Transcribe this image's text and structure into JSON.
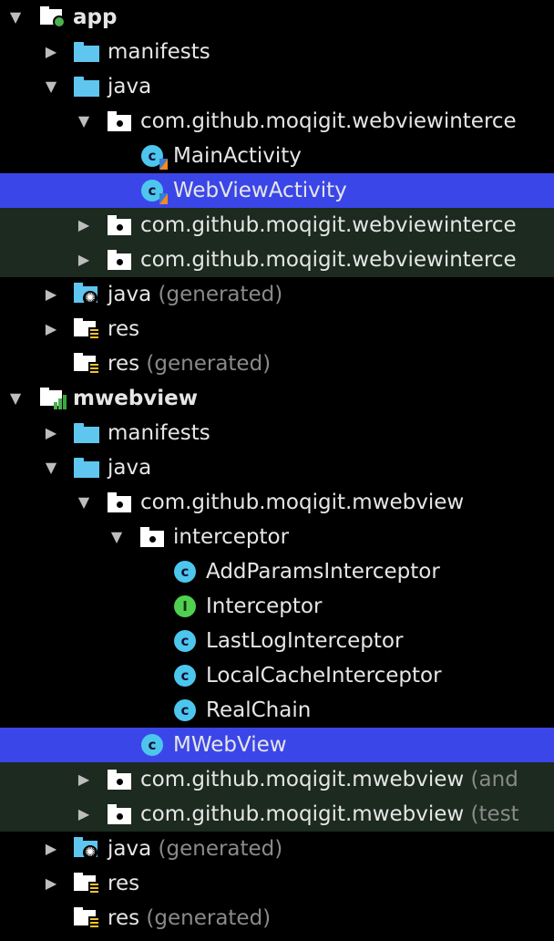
{
  "tree": {
    "rows": [
      {
        "label": "app",
        "suffix": "",
        "level": 0,
        "arrow": "expanded",
        "icon": "module-app-icon",
        "state": "",
        "bold": true
      },
      {
        "label": "manifests",
        "suffix": "",
        "level": 1,
        "arrow": "collapsed",
        "icon": "folder-icon",
        "state": ""
      },
      {
        "label": "java",
        "suffix": "",
        "level": 1,
        "arrow": "expanded",
        "icon": "folder-icon",
        "state": ""
      },
      {
        "label": "com.github.moqigit.webviewinterce",
        "suffix": "",
        "level": 2,
        "arrow": "expanded",
        "icon": "package-icon",
        "state": ""
      },
      {
        "label": "MainActivity",
        "suffix": "",
        "level": 3,
        "arrow": "none",
        "icon": "kotlin-class-icon",
        "state": ""
      },
      {
        "label": "WebViewActivity",
        "suffix": "",
        "level": 3,
        "arrow": "none",
        "icon": "kotlin-class-icon",
        "state": "selected"
      },
      {
        "label": "com.github.moqigit.webviewinterce",
        "suffix": "",
        "level": 2,
        "arrow": "collapsed",
        "icon": "package-icon",
        "state": "test"
      },
      {
        "label": "com.github.moqigit.webviewinterce",
        "suffix": "",
        "level": 2,
        "arrow": "collapsed",
        "icon": "package-icon",
        "state": "test"
      },
      {
        "label": "java",
        "suffix": "(generated)",
        "level": 1,
        "arrow": "collapsed",
        "icon": "generated-java-folder-icon",
        "state": ""
      },
      {
        "label": "res",
        "suffix": "",
        "level": 1,
        "arrow": "collapsed",
        "icon": "resource-folder-icon",
        "state": ""
      },
      {
        "label": "res",
        "suffix": "(generated)",
        "level": 1,
        "arrow": "none",
        "icon": "resource-folder-icon",
        "state": ""
      },
      {
        "label": "mwebview",
        "suffix": "",
        "level": 0,
        "arrow": "expanded",
        "icon": "module-library-icon",
        "state": "",
        "bold": true
      },
      {
        "label": "manifests",
        "suffix": "",
        "level": 1,
        "arrow": "collapsed",
        "icon": "folder-icon",
        "state": ""
      },
      {
        "label": "java",
        "suffix": "",
        "level": 1,
        "arrow": "expanded",
        "icon": "folder-icon",
        "state": ""
      },
      {
        "label": "com.github.moqigit.mwebview",
        "suffix": "",
        "level": 2,
        "arrow": "expanded",
        "icon": "package-icon",
        "state": ""
      },
      {
        "label": "interceptor",
        "suffix": "",
        "level": 3,
        "arrow": "expanded",
        "icon": "package-icon",
        "state": ""
      },
      {
        "label": "AddParamsInterceptor",
        "suffix": "",
        "level": 4,
        "arrow": "none",
        "icon": "class-icon",
        "state": ""
      },
      {
        "label": "Interceptor",
        "suffix": "",
        "level": 4,
        "arrow": "none",
        "icon": "interface-icon",
        "state": ""
      },
      {
        "label": "LastLogInterceptor",
        "suffix": "",
        "level": 4,
        "arrow": "none",
        "icon": "class-icon",
        "state": ""
      },
      {
        "label": "LocalCacheInterceptor",
        "suffix": "",
        "level": 4,
        "arrow": "none",
        "icon": "class-icon",
        "state": ""
      },
      {
        "label": "RealChain",
        "suffix": "",
        "level": 4,
        "arrow": "none",
        "icon": "class-icon",
        "state": ""
      },
      {
        "label": "MWebView",
        "suffix": "",
        "level": 3,
        "arrow": "none",
        "icon": "class-icon",
        "state": "selected"
      },
      {
        "label": "com.github.moqigit.mwebview",
        "suffix": "(and",
        "level": 2,
        "arrow": "collapsed",
        "icon": "package-icon",
        "state": "test"
      },
      {
        "label": "com.github.moqigit.mwebview",
        "suffix": "(test",
        "level": 2,
        "arrow": "collapsed",
        "icon": "package-icon",
        "state": "test"
      },
      {
        "label": "java",
        "suffix": "(generated)",
        "level": 1,
        "arrow": "collapsed",
        "icon": "generated-java-folder-icon",
        "state": ""
      },
      {
        "label": "res",
        "suffix": "",
        "level": 1,
        "arrow": "collapsed",
        "icon": "resource-folder-icon",
        "state": ""
      },
      {
        "label": "res",
        "suffix": "(generated)",
        "level": 1,
        "arrow": "none",
        "icon": "resource-folder-icon",
        "state": ""
      }
    ]
  },
  "colors": {
    "selection": "#3b46e8",
    "test_row": "#1c2a1f",
    "folder": "#5fc6f0",
    "class": "#4dc6ee",
    "interface": "#4fd14f"
  }
}
